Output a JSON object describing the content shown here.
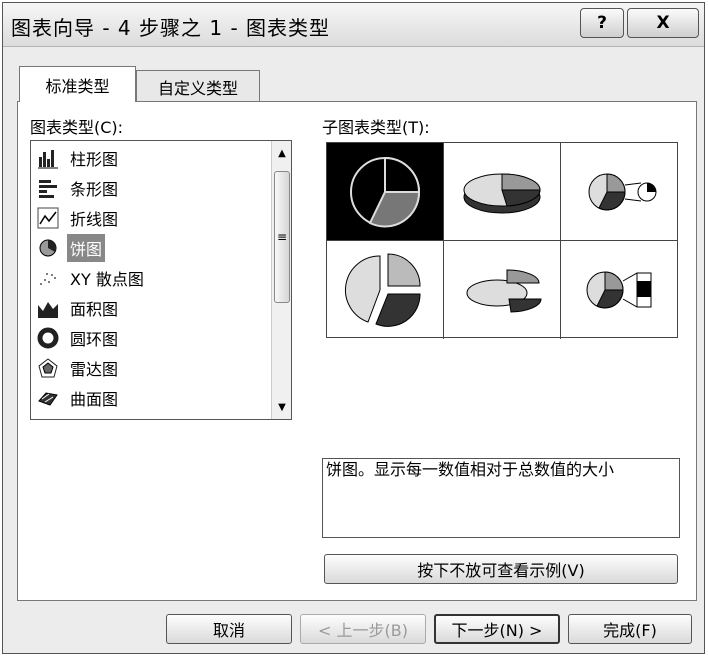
{
  "window": {
    "title": "图表向导 - 4 步骤之 1 - 图表类型"
  },
  "titlebar": {
    "help_icon": "?",
    "close_icon": "X"
  },
  "tabs": [
    {
      "label": "标准类型",
      "active": true
    },
    {
      "label": "自定义类型",
      "active": false
    }
  ],
  "chart_types": {
    "label": "图表类型(C):",
    "items": [
      {
        "label": "柱形图",
        "icon": "column-chart-icon"
      },
      {
        "label": "条形图",
        "icon": "bar-chart-icon"
      },
      {
        "label": "折线图",
        "icon": "line-chart-icon"
      },
      {
        "label": "饼图",
        "icon": "pie-chart-icon",
        "selected": true
      },
      {
        "label": "XY 散点图",
        "icon": "scatter-chart-icon"
      },
      {
        "label": "面积图",
        "icon": "area-chart-icon"
      },
      {
        "label": "圆环图",
        "icon": "doughnut-chart-icon"
      },
      {
        "label": "雷达图",
        "icon": "radar-chart-icon"
      },
      {
        "label": "曲面图",
        "icon": "surface-chart-icon"
      }
    ]
  },
  "subtypes": {
    "label": "子图表类型(T):",
    "selected_index": 0
  },
  "description": "饼图。显示每一数值相对于总数值的大小",
  "preview_button": "按下不放可查看示例(V)",
  "footer": {
    "cancel": "取消",
    "back": "< 上一步(B)",
    "next": "下一步(N) >",
    "finish": "完成(F)"
  }
}
